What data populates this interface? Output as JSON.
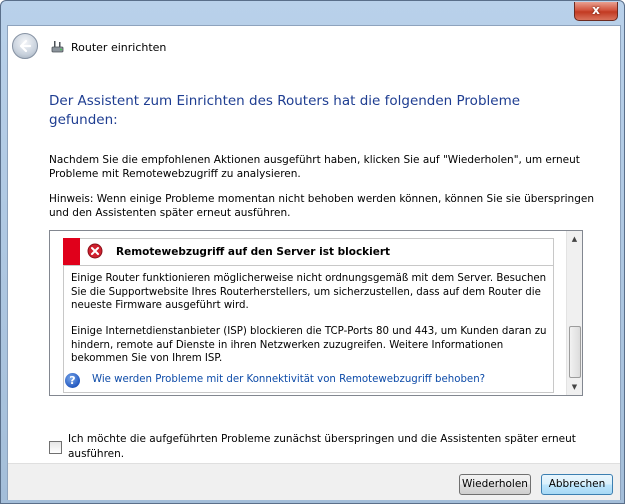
{
  "window": {
    "close_label": "x"
  },
  "header": {
    "title": "Router einrichten"
  },
  "main": {
    "heading": "Der Assistent zum Einrichten des Routers hat die folgenden Probleme gefunden:",
    "instruction": "Nachdem Sie die empfohlenen Aktionen ausgeführt haben, klicken Sie auf \"Wiederholen\", um erneut Probleme mit Remotewebzugriff zu analysieren.",
    "hint": "Hinweis: Wenn einige Probleme momentan nicht behoben werden können, können Sie sie überspringen und den Assistenten später erneut ausführen."
  },
  "problem": {
    "title": "Remotewebzugriff auf den Server ist blockiert",
    "text1": "Einige Router funktionieren möglicherweise nicht ordnungsgemäß mit dem Server. Besuchen Sie die Supportwebsite Ihres Routerherstellers, um sicherzustellen, dass auf dem Router die neueste Firmware ausgeführt wird.",
    "text2": "Einige Internetdienstanbieter (ISP) blockieren die TCP-Ports 80 und 443, um Kunden daran zu hindern, remote auf Dienste in ihren Netzwerken zuzugreifen. Weitere Informationen bekommen Sie von Ihrem ISP.",
    "help_icon_glyph": "?",
    "help_link": "Wie werden Probleme mit der Konnektivität von Remotewebzugriff behoben?",
    "status_color": "#e0001b"
  },
  "skip": {
    "label": "Ich möchte die aufgeführten Probleme zunächst überspringen und die Assistenten später erneut ausführen.",
    "checked": false
  },
  "footer": {
    "retry_label": "Wiederholen",
    "cancel_label": "Abbrechen"
  },
  "icons": {
    "back": "back-arrow-icon",
    "router": "router-icon",
    "error": "error-icon",
    "help": "help-icon"
  }
}
